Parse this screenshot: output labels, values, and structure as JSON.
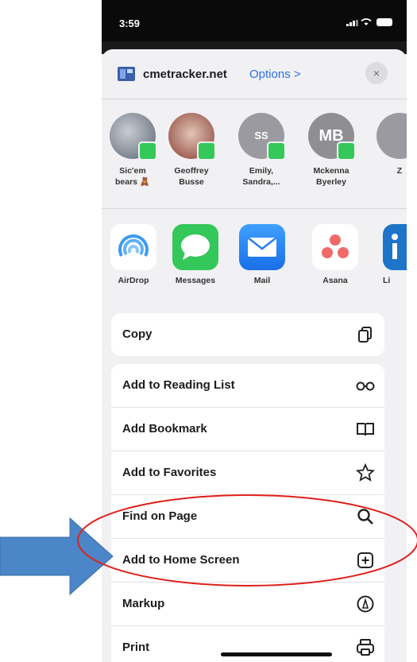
{
  "status": {
    "time": "3:59"
  },
  "header": {
    "site": "cmetracker.net",
    "options": "Options >",
    "close": "×"
  },
  "people": [
    {
      "name_line1": "Sic'em",
      "name_line2": "bears 🧸",
      "initials": "",
      "color": "#6e6e73"
    },
    {
      "name_line1": "Geoffrey",
      "name_line2": "Busse",
      "initials": "",
      "color": "#a36a5a"
    },
    {
      "name_line1": "Emily,",
      "name_line2": "Sandra,...",
      "initials": "SS",
      "color": "#8e8e93"
    },
    {
      "name_line1": "Mckenna",
      "name_line2": "Byerley",
      "initials": "MB",
      "color": "#8e8e93"
    },
    {
      "name_line1": "",
      "name_line2": "Z",
      "initials": "",
      "color": "#8e8e93"
    }
  ],
  "apps": [
    {
      "name": "AirDrop"
    },
    {
      "name": "Messages"
    },
    {
      "name": "Mail"
    },
    {
      "name": "Asana"
    },
    {
      "name": "Li"
    }
  ],
  "actions": {
    "copy": "Copy",
    "reading_list": "Add to Reading List",
    "bookmark": "Add Bookmark",
    "favorites": "Add to Favorites",
    "find": "Find on Page",
    "home_screen": "Add to Home Screen",
    "markup": "Markup",
    "print": "Print"
  },
  "colors": {
    "accent": "#2f6fe3",
    "messages_green": "#34c759",
    "mail_blue": "#1a7cf5",
    "asana_red": "#f06a6a",
    "annotation_red": "#e0201a",
    "arrow_blue": "#4a86c8"
  }
}
